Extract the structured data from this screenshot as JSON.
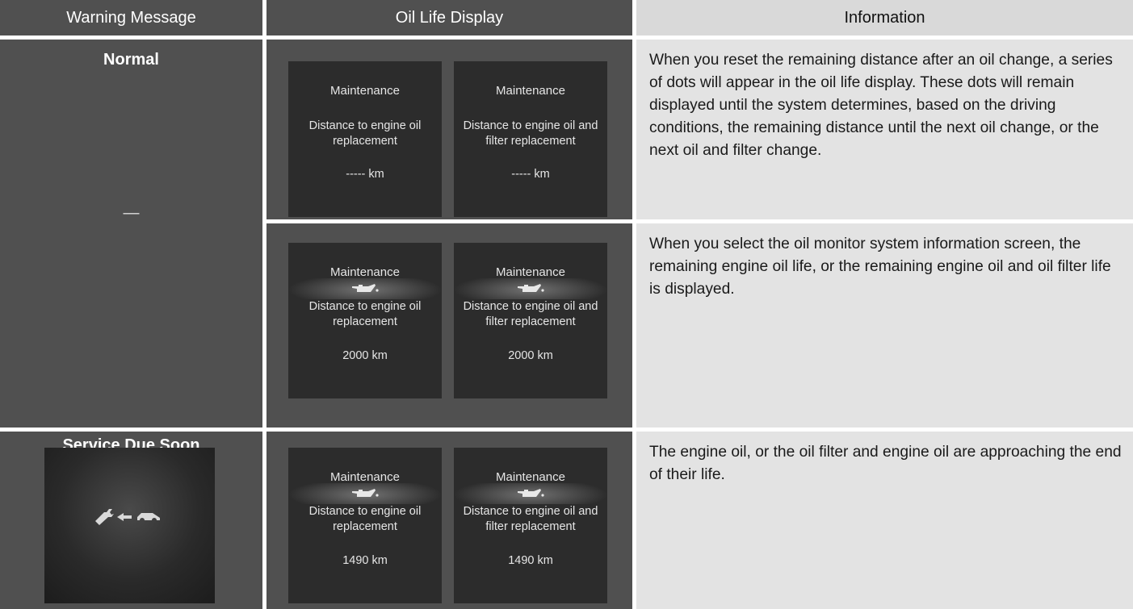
{
  "header": {
    "col1": "Warning Message",
    "col2": "Oil Life Display",
    "col3": "Information"
  },
  "rows": [
    {
      "warning": "Normal",
      "dash": "—",
      "panels": [
        {
          "title": "Maintenance",
          "desc": "Distance to engine oil replacement",
          "value": "----- km",
          "icon": ""
        },
        {
          "title": "Maintenance",
          "desc": "Distance to engine oil and filter replacement",
          "value": "----- km",
          "icon": ""
        }
      ],
      "info": "When you reset the remaining distance after an oil change, a series of dots will appear in the oil life display. These dots will remain displayed until the system determines, based on the driving conditions, the remaining distance until the next oil change, or the next oil and filter change."
    },
    {
      "panels": [
        {
          "title": "Maintenance",
          "desc": "Distance to engine oil replacement",
          "value": "2000 km",
          "icon": "oil-can-icon"
        },
        {
          "title": "Maintenance",
          "desc": "Distance to engine oil and filter replacement",
          "value": "2000 km",
          "icon": "oil-can-icon"
        }
      ],
      "info": "When you select the oil monitor system information screen, the remaining engine oil life, or the remaining engine oil and oil filter life is displayed."
    },
    {
      "warning": "Service Due Soon",
      "warning_icon": "wrench-arrow-car-icon",
      "panels": [
        {
          "title": "Maintenance",
          "desc": "Distance to engine oil replacement",
          "value": "1490 km",
          "icon": "oil-can-icon"
        },
        {
          "title": "Maintenance",
          "desc": "Distance to engine oil and filter replacement",
          "value": "1490 km",
          "icon": "oil-can-icon"
        }
      ],
      "info": "The engine oil, or the oil filter and engine oil are approaching the end of their life."
    }
  ],
  "colors": {
    "header_dark": "#505050",
    "header_light": "#d9d9d9",
    "panel_bg": "#2c2c2c",
    "info_bg": "#e3e3e3"
  }
}
